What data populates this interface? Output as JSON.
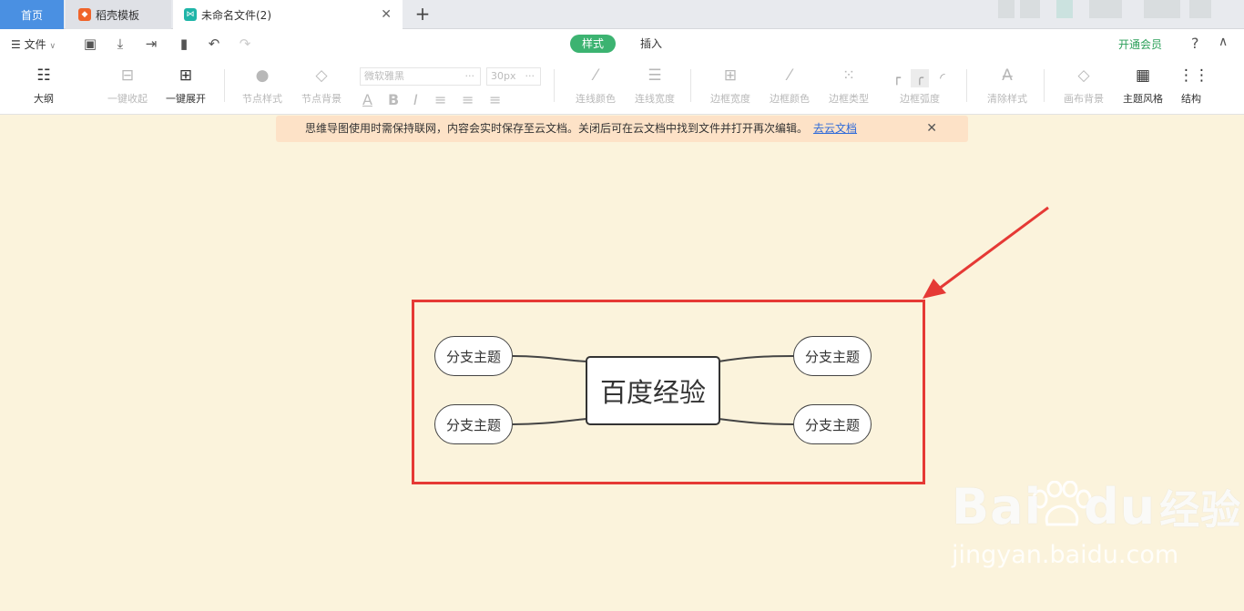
{
  "tabs": {
    "home": "首页",
    "template": "稻壳模板",
    "document": "未命名文件(2)"
  },
  "menu": {
    "file": "文件",
    "mode_style": "样式",
    "mode_insert": "插入",
    "vip": "开通会员",
    "help": "?"
  },
  "toolbar": {
    "outline": "大纲",
    "collapse_all": "一键收起",
    "expand_all": "一键展开",
    "node_style": "节点样式",
    "node_bg": "节点背景",
    "font_family": "微软雅黑",
    "font_size": "30px",
    "line_color": "连线颜色",
    "line_width": "连线宽度",
    "border_width": "边框宽度",
    "border_color": "边框颜色",
    "border_type": "边框类型",
    "border_radius": "边框弧度",
    "clear_style": "清除样式",
    "canvas_bg": "画布背景",
    "theme_style": "主题风格",
    "structure": "结构"
  },
  "notice": {
    "text": "思维导图使用时需保持联网，内容会实时保存至云文档。关闭后可在云文档中找到文件并打开再次编辑。",
    "link": "去云文档"
  },
  "mindmap": {
    "central": "百度经验",
    "branches": [
      "分支主题",
      "分支主题",
      "分支主题",
      "分支主题"
    ]
  },
  "watermark": {
    "brand": "Bai",
    "brand_tail": "du",
    "suffix": "经验",
    "url": "jingyan.baidu.com"
  },
  "colors": {
    "canvas": "#fbf3dc",
    "accent_green": "#3cb371",
    "highlight_red": "#e53935",
    "home_tab": "#4a90e2"
  },
  "icons": {
    "outline": "outline-icon",
    "collapse": "minus-square-icon",
    "expand": "plus-square-icon",
    "annotation": "red-arrow"
  }
}
